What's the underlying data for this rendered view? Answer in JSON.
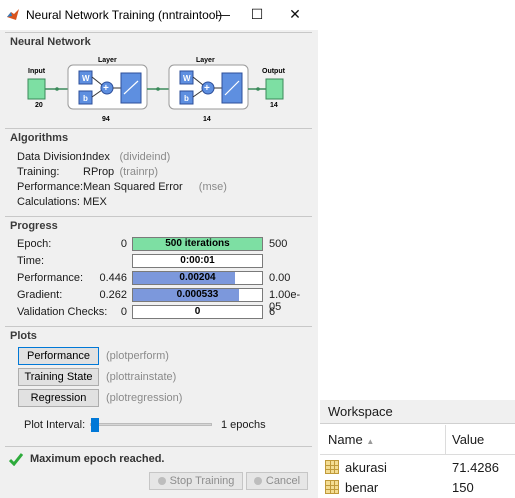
{
  "window": {
    "title": "Neural Network Training (nntraintool)",
    "minimize_glyph": "—",
    "maximize_glyph": "☐",
    "close_glyph": "✕"
  },
  "network": {
    "section_title": "Neural Network",
    "input_label": "Input",
    "input_size": "20",
    "layer1_label": "Layer",
    "layer1_size": "94",
    "layer2_label": "Layer",
    "layer2_size": "14",
    "output_label": "Output",
    "output_size": "14",
    "weight_symbol": "W",
    "bias_symbol": "b",
    "sum_symbol": "+"
  },
  "algorithms": {
    "section_title": "Algorithms",
    "rows": [
      {
        "label": "Data Division:",
        "value": "Index",
        "note": "(divideind)"
      },
      {
        "label": "Training:",
        "value": "RProp",
        "note": "(trainrp)"
      },
      {
        "label": "Performance:",
        "value": "Mean Squared Error",
        "note": "(mse)"
      },
      {
        "label": "Calculations:",
        "value": "MEX",
        "note": ""
      }
    ]
  },
  "progress": {
    "section_title": "Progress",
    "rows": [
      {
        "label": "Epoch:",
        "min": "0",
        "value": "500 iterations",
        "max": "500",
        "fill": 1.0,
        "color": "#7ddfa3"
      },
      {
        "label": "Time:",
        "min": "",
        "value": "0:00:01",
        "max": "",
        "fill": 0,
        "color": "#ffffff"
      },
      {
        "label": "Performance:",
        "min": "0.446",
        "value": "0.00204",
        "max": "0.00",
        "fill": 0.79,
        "color": "#7c98dc"
      },
      {
        "label": "Gradient:",
        "min": "0.262",
        "value": "0.000533",
        "max": "1.00e-05",
        "fill": 0.82,
        "color": "#7c98dc"
      },
      {
        "label": "Validation Checks:",
        "min": "0",
        "value": "0",
        "max": "6",
        "fill": 0,
        "color": "#ffffff"
      }
    ]
  },
  "plots": {
    "section_title": "Plots",
    "buttons": [
      {
        "label": "Performance",
        "note": "(plotperform)"
      },
      {
        "label": "Training State",
        "note": "(plottrainstate)"
      },
      {
        "label": "Regression",
        "note": "(plotregression)"
      }
    ],
    "interval_label": "Plot Interval:",
    "interval_value": "1 epochs",
    "interval_fraction": 0.0
  },
  "status": {
    "message": "Maximum epoch reached.",
    "stop_label": "Stop Training",
    "cancel_label": "Cancel"
  },
  "workspace": {
    "title": "Workspace",
    "columns": [
      "Name",
      "Value"
    ],
    "sort_glyph": "▲",
    "variables": [
      {
        "name": "akurasi",
        "value": "71.4286"
      },
      {
        "name": "benar",
        "value": "150"
      }
    ]
  },
  "colors": {
    "epoch_fill": "#7ddfa3",
    "perf_fill": "#7c98dc",
    "block_blue": "#5e8fe0",
    "io_green": "#7ddfa3",
    "check_green": "#2eab3c"
  }
}
